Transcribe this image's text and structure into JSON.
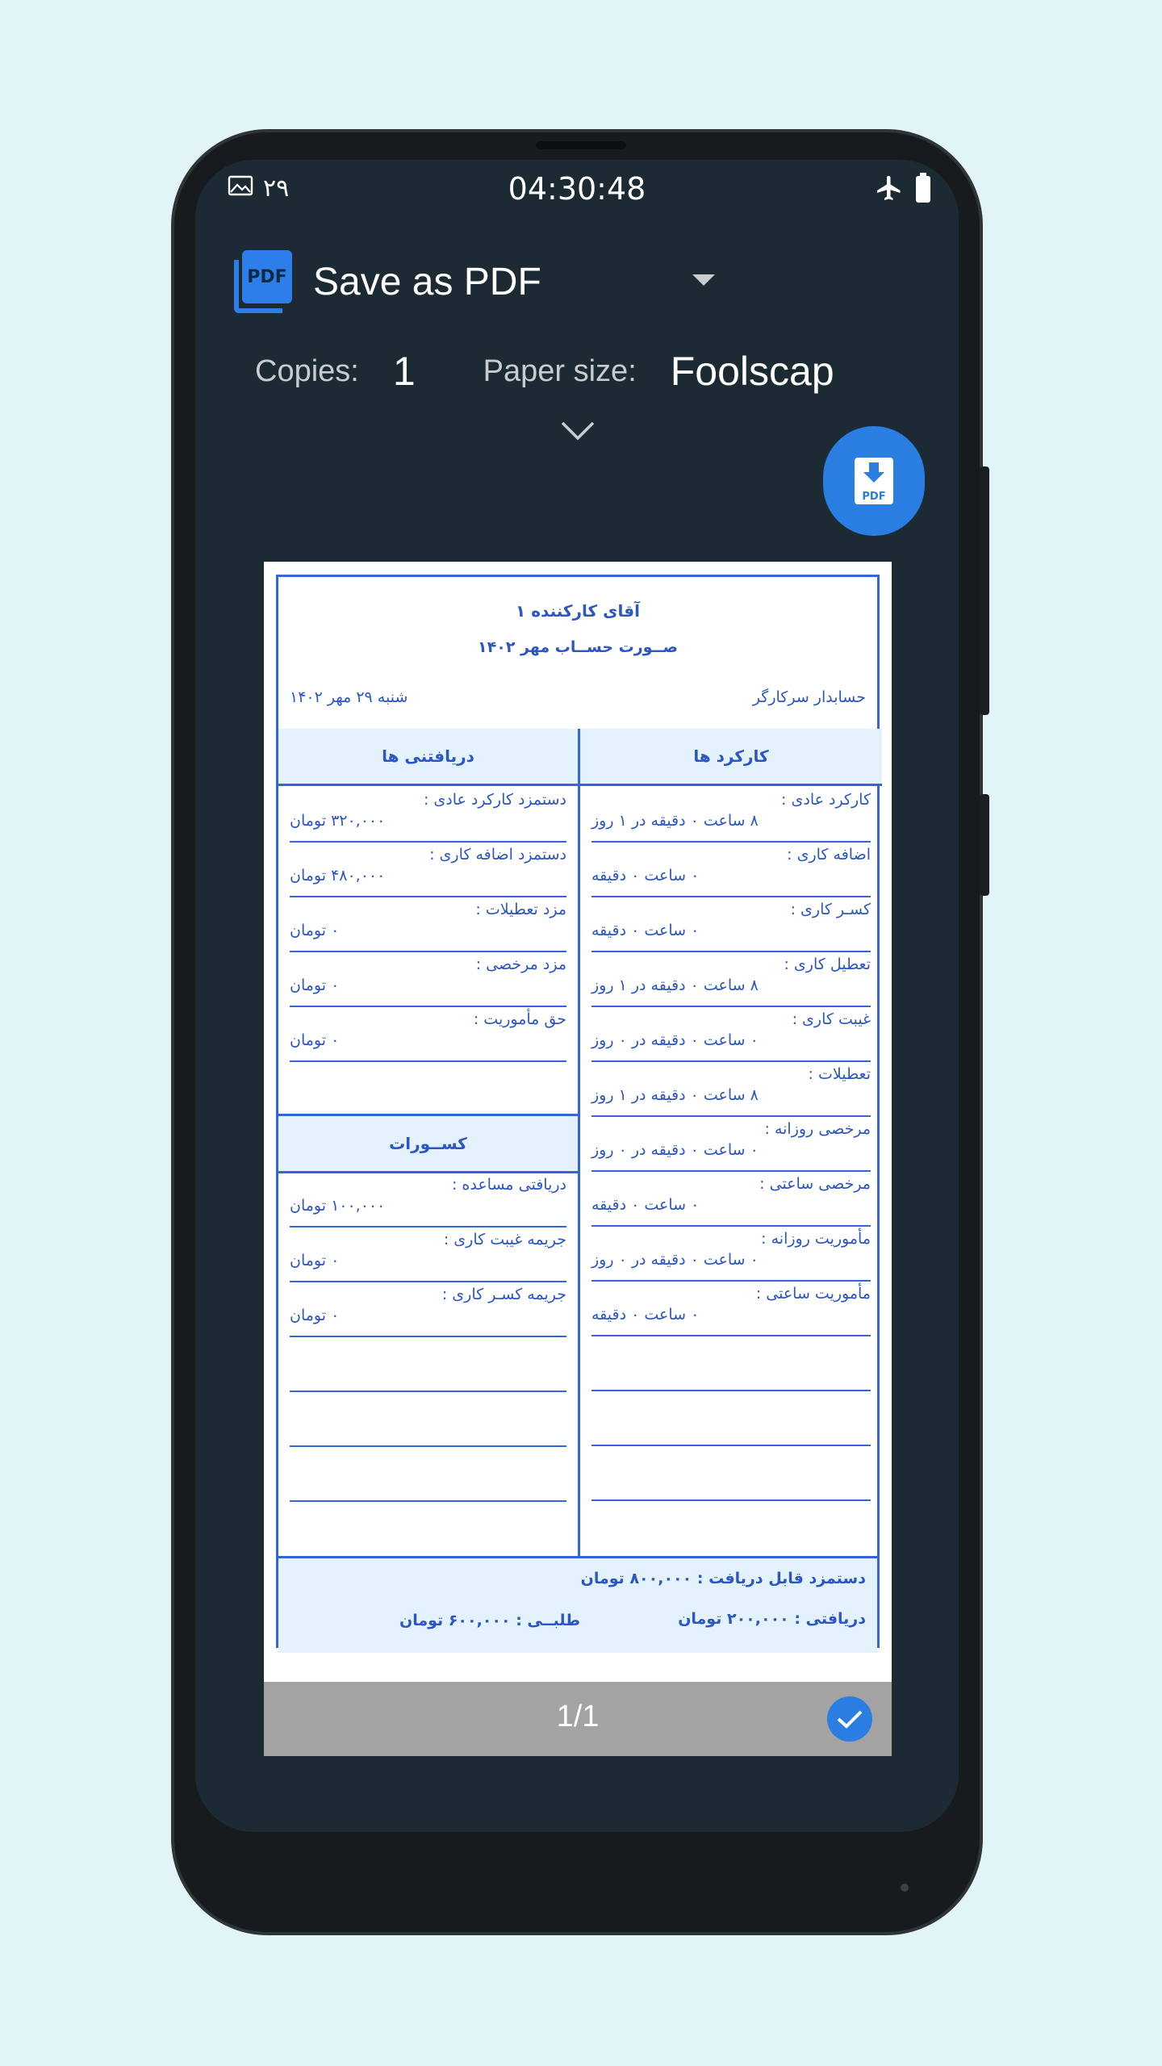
{
  "status_bar": {
    "left_number": "۲۹",
    "time": "04:30:48"
  },
  "print": {
    "printer_name": "Save as PDF",
    "copies_label": "Copies:",
    "copies_value": "1",
    "paper_size_label": "Paper size:",
    "paper_size_value": "Foolscap",
    "fab_label": "PDF",
    "pdf_logo_text": "PDF"
  },
  "document": {
    "title": "آقای کارکننده ۱",
    "subtitle": "صــورت حســاب مهر ۱۴۰۲",
    "header_right": "حسابدار سرکارگر",
    "header_left": "شنبه ۲۹ مهر ۱۴۰۲",
    "work_header": "کارکرد ها",
    "income_header": "دریافتنی ها",
    "deductions_header": "کســورات",
    "work_rows": [
      {
        "label": "کارکرد عادی :",
        "value": "۸ ساعت ۰ دقیقه در ۱ روز"
      },
      {
        "label": "اضافه کاری :",
        "value": "۰ ساعت ۰ دقیقه"
      },
      {
        "label": "کسـر کاری :",
        "value": "۰ ساعت ۰ دقیقه"
      },
      {
        "label": "تعطیل کاری :",
        "value": "۸ ساعت ۰ دقیقه در ۱ روز"
      },
      {
        "label": "غیبت کاری :",
        "value": "۰ ساعت ۰ دقیقه در ۰ روز"
      },
      {
        "label": "تعطیلات :",
        "value": "۸ ساعت ۰ دقیقه در ۱ روز"
      },
      {
        "label": "مرخصی روزانه :",
        "value": "۰ ساعت ۰ دقیقه در ۰ روز"
      },
      {
        "label": "مرخصی ساعتی :",
        "value": "۰ ساعت ۰ دقیقه"
      },
      {
        "label": "مأموریت روزانه :",
        "value": "۰ ساعت ۰ دقیقه در ۰ روز"
      },
      {
        "label": "مأموریت ساعتی :",
        "value": "۰ ساعت ۰ دقیقه"
      }
    ],
    "income_rows": [
      {
        "label": "دستمزد کارکرد عادی :",
        "value": "۳۲۰,۰۰۰ تومان"
      },
      {
        "label": "دستمزد اضافه کاری :",
        "value": "۴۸۰,۰۰۰ تومان"
      },
      {
        "label": "مزد تعطیلات :",
        "value": "۰ تومان"
      },
      {
        "label": "مزد مرخصی :",
        "value": "۰ تومان"
      },
      {
        "label": "حق مأموریت :",
        "value": "۰ تومان"
      }
    ],
    "deduction_rows": [
      {
        "label": "دریافتی مساعده :",
        "value": "۱۰۰,۰۰۰ تومان"
      },
      {
        "label": "جریمه غیبت کاری :",
        "value": "۰ تومان"
      },
      {
        "label": "جریمه کسـر کاری :",
        "value": "۰ تومان"
      }
    ],
    "footer": {
      "payable": "دستمزد قابل دریافت :  ۸۰۰,۰۰۰ تومان",
      "received": "دریافتی :  ۲۰۰,۰۰۰ تومان",
      "balance": "طلبــی :  ۶۰۰,۰۰۰ تومان"
    }
  },
  "pager": {
    "text": "1/1"
  },
  "colors": {
    "accent": "#2a7de1",
    "doc_blue": "#3467d6",
    "screen_bg": "#1c2a33",
    "page_bg": "#e1f5f8"
  }
}
